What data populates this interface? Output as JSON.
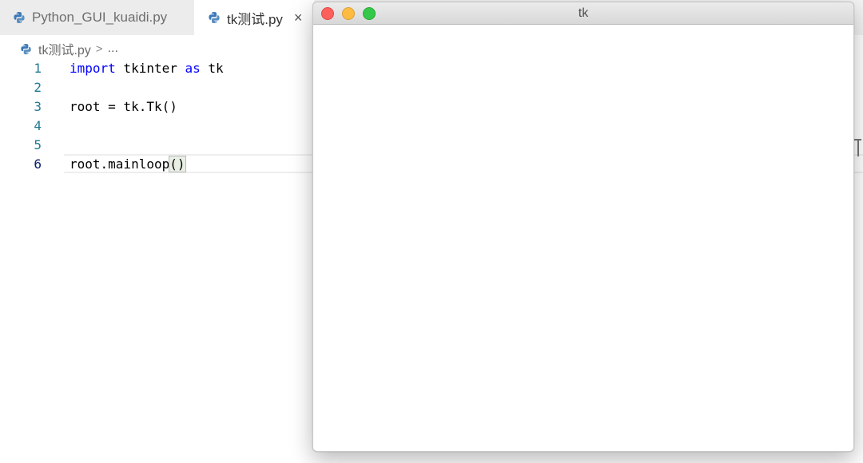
{
  "editor": {
    "tabs": [
      {
        "label": "Python_GUI_kuaidi.py",
        "active": false
      },
      {
        "label": "tk测试.py",
        "active": true,
        "close_icon": "×"
      }
    ],
    "breadcrumb": {
      "file": "tk测试.py",
      "separator": ">",
      "ellipsis": "..."
    },
    "code_lines": [
      {
        "number": "1",
        "pre": "",
        "keyword1": "import",
        "mid": " tkinter ",
        "keyword2": "as",
        "post": " tk"
      },
      {
        "number": "2",
        "text": ""
      },
      {
        "number": "3",
        "text": "root = tk.Tk()"
      },
      {
        "number": "4",
        "text": ""
      },
      {
        "number": "5",
        "text": ""
      },
      {
        "number": "6",
        "text_before": "root.mainloop",
        "paren_open": "(",
        "paren_close": ")",
        "current": true
      }
    ]
  },
  "tk_window": {
    "title": "tk",
    "controls": [
      "close-button",
      "minimize-button",
      "zoom-button"
    ]
  },
  "colors": {
    "keyword": "#0000ff",
    "line_number": "#237893",
    "active_line_number": "#0b216f",
    "close": "#fc605c",
    "minimize": "#fdbc40",
    "zoom": "#34c84a"
  }
}
